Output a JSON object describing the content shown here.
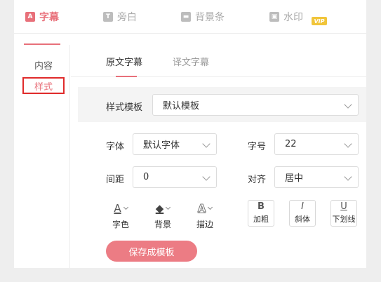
{
  "tabs": [
    {
      "label": "字幕",
      "icon": "A",
      "icon_name": "subtitle-icon"
    },
    {
      "label": "旁白",
      "icon": "T",
      "icon_name": "narration-icon"
    },
    {
      "label": "背景条",
      "icon": "▬",
      "icon_name": "background-bar-icon"
    },
    {
      "label": "水印",
      "icon": "▣",
      "icon_name": "watermark-icon",
      "badge": "VIP"
    }
  ],
  "sidebar": {
    "items": [
      {
        "label": "内容"
      },
      {
        "label": "样式"
      }
    ]
  },
  "subtabs": [
    {
      "label": "原文字幕"
    },
    {
      "label": "译文字幕"
    }
  ],
  "style_template": {
    "label": "样式模板",
    "value": "默认模板"
  },
  "font": {
    "label": "字体",
    "value": "默认字体"
  },
  "font_size": {
    "label": "字号",
    "value": "22"
  },
  "spacing": {
    "label": "间距",
    "value": "0"
  },
  "align": {
    "label": "对齐",
    "value": "居中"
  },
  "tools": {
    "color": {
      "label": "字色",
      "glyph": "A"
    },
    "background": {
      "label": "背景",
      "glyph": "◆"
    },
    "stroke": {
      "label": "描边",
      "glyph": "A"
    }
  },
  "format_buttons": [
    {
      "glyph": "B",
      "label": "加粗"
    },
    {
      "glyph": "I",
      "label": "斜体"
    },
    {
      "glyph": "U",
      "label": "下划线"
    }
  ],
  "save_button": {
    "label": "保存成模板"
  },
  "colors": {
    "accent": "#e8707a",
    "button": "#ec7c84",
    "vip": "#f1c53a",
    "selected_border": "#e02b2b"
  }
}
